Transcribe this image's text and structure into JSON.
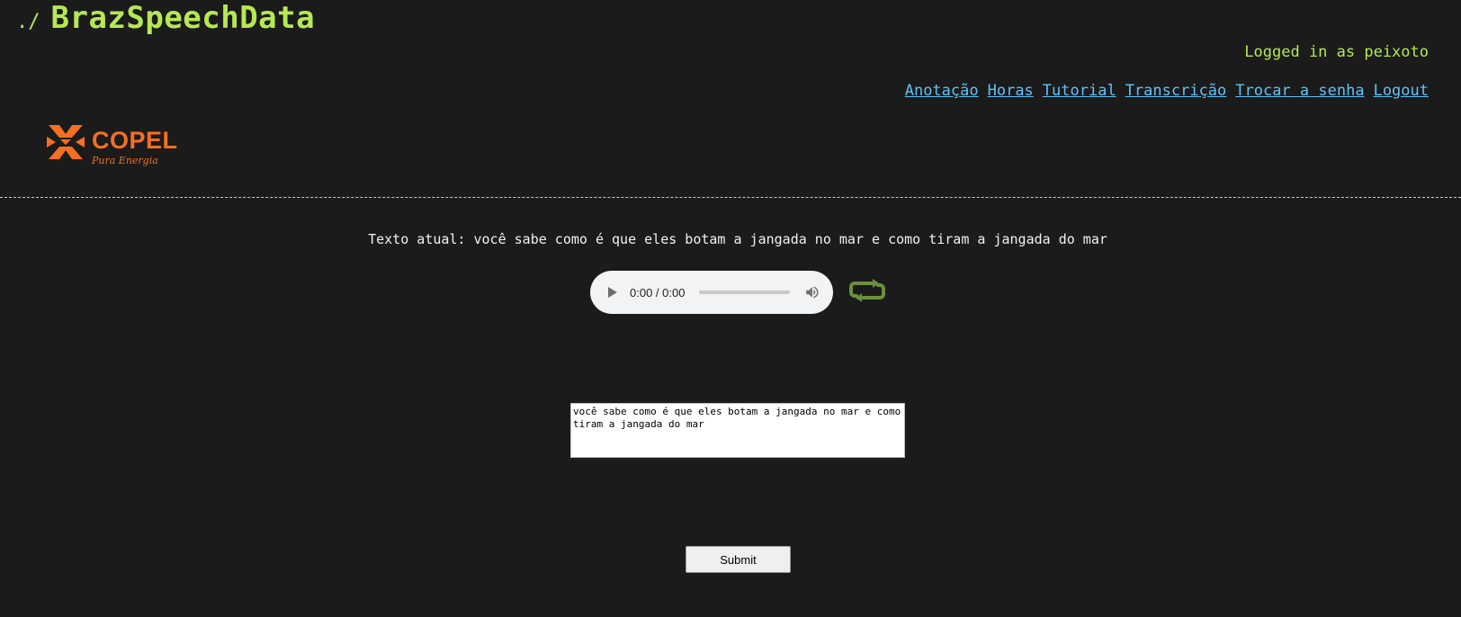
{
  "header": {
    "prefix": "./",
    "title": "BrazSpeechData",
    "logged_in": "Logged in as peixoto"
  },
  "nav": {
    "items": [
      "Anotação",
      "Horas",
      "Tutorial",
      "Transcrição",
      "Trocar a senha",
      "Logout"
    ]
  },
  "logo": {
    "name": "COPEL",
    "tagline": "Pura Energia",
    "color": "#f36f21"
  },
  "main": {
    "current_text": "Texto atual: você sabe como é que eles botam a jangada no mar e como tiram a jangada do mar",
    "audio": {
      "time": "0:00 / 0:00"
    },
    "transcript_value": "você sabe como é que eles botam a jangada no mar e como tiram a jangada do mar",
    "submit_label": "Submit"
  },
  "colors": {
    "background": "#1b1b1b",
    "accent": "#b5e853",
    "link": "#63c0f5",
    "loop_icon": "#6c8f3b"
  },
  "icons": {
    "play": "play-icon",
    "volume": "volume-icon",
    "loop": "loop-icon"
  }
}
